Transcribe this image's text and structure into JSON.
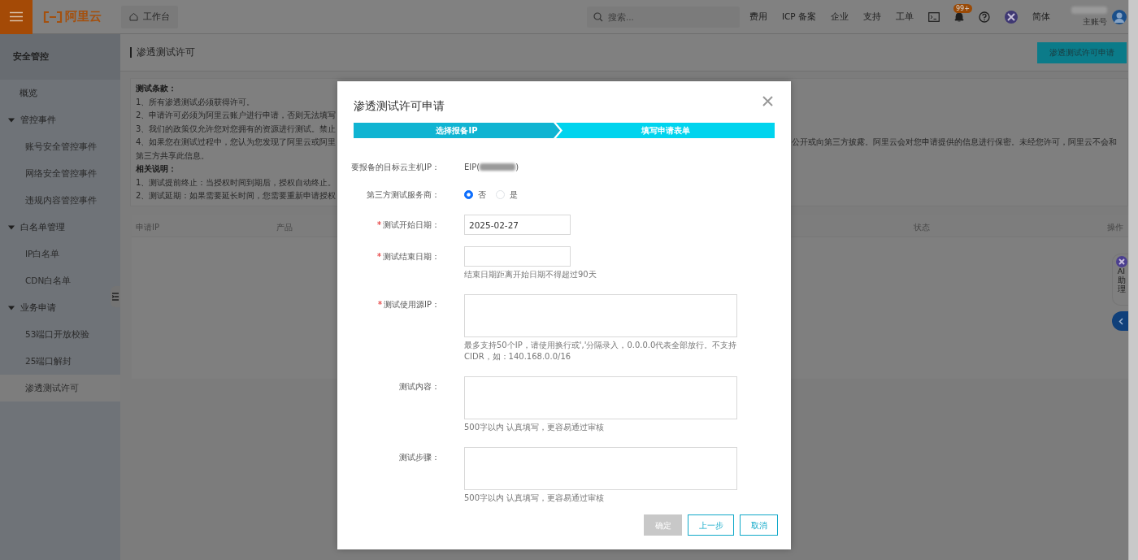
{
  "header": {
    "logo_text": "阿里云",
    "workbench": "工作台",
    "search": {
      "placeholder": "搜索..."
    },
    "links": [
      "费用",
      "ICP 备案",
      "企业",
      "支持",
      "工单"
    ],
    "notification_badge": "99+",
    "language": "简体",
    "account": {
      "name_redacted": true,
      "role": "主账号"
    }
  },
  "sidebar": {
    "title": "安全管控",
    "items": [
      {
        "label": "概览",
        "selected": false
      },
      {
        "label": "管控事件",
        "selected": false,
        "expanded": true,
        "children": [
          {
            "label": "账号安全管控事件",
            "selected": false
          },
          {
            "label": "网络安全管控事件",
            "selected": false
          },
          {
            "label": "违规内容管控事件",
            "selected": false
          }
        ]
      },
      {
        "label": "白名单管理",
        "selected": false,
        "expanded": true,
        "children": [
          {
            "label": "IP白名单",
            "selected": false
          },
          {
            "label": "CDN白名单",
            "selected": false
          }
        ]
      },
      {
        "label": "业务申请",
        "selected": false,
        "expanded": true,
        "children": [
          {
            "label": "53端口开放校验",
            "selected": false
          },
          {
            "label": "25端口解封",
            "selected": false
          },
          {
            "label": "渗透测试许可",
            "selected": true
          }
        ]
      }
    ]
  },
  "page": {
    "title": "渗透测试许可",
    "apply_button": "渗透测试许可申请",
    "notice": [
      {
        "kind": "heading",
        "text": "测试条款："
      },
      {
        "kind": "line",
        "text": "1、所有渗透测试必须获得许可。"
      },
      {
        "kind": "line",
        "text": "2、申请许可必须为阿里云账户进行申请，否则无法填写"
      },
      {
        "kind": "line",
        "text": "3、我们的政策仅允许您对您拥有的资源进行测试。禁止"
      },
      {
        "kind": "line",
        "text": "4、如果您在测试过程中，您认为您发现了阿里云或阿里",
        "text_right": "公开或向第三方披露。阿里云会对您申请提供的信息进行保密。未经您许可，阿里云不会和"
      },
      {
        "kind": "line",
        "text": "第三方共享此信息。"
      },
      {
        "kind": "heading",
        "text": "相关说明："
      },
      {
        "kind": "line",
        "text": "1、测试提前终止：当授权时间到期后，授权自动终止。"
      },
      {
        "kind": "line",
        "text": "2、测试延期：如果需要延长时间，您需要重新申请授权"
      }
    ],
    "table": {
      "columns": [
        "申请IP",
        "产品",
        "状态",
        "操作"
      ]
    }
  },
  "assistant": {
    "label_latin": "AI",
    "label_cjk": "助理"
  },
  "modal": {
    "title": "渗透测试许可申请",
    "steps": [
      {
        "label": "选择报备IP",
        "selected": false
      },
      {
        "label": "填写申请表单",
        "selected": true
      }
    ],
    "fields": [
      {
        "kind": "static",
        "label": "要报备的目标云主机IP：",
        "prefix": "EIP(",
        "suffix": ")",
        "redacted": true
      },
      {
        "kind": "radio",
        "label": "第三方测试服务商：",
        "options": [
          {
            "label": "否",
            "selected": true
          },
          {
            "label": "是",
            "selected": false
          }
        ]
      },
      {
        "kind": "input",
        "label": "测试开始日期：",
        "required": true,
        "value": "2025-02-27"
      },
      {
        "kind": "input",
        "label": "测试结束日期：",
        "required": true,
        "help": "结束日期距离开始日期不得超过90天"
      },
      {
        "kind": "textarea",
        "label": "测试使用源IP：",
        "required": true,
        "help": "最多支持50个IP，请使用换行或','分隔录入，0.0.0.0代表全部放行。不支持CIDR，如：140.168.0.0/16"
      },
      {
        "kind": "textarea",
        "label": "测试内容：",
        "required": false,
        "help": "500字以内 认真填写，更容易通过审核"
      },
      {
        "kind": "textarea",
        "label": "测试步骤：",
        "required": false,
        "help": "500字以内 认真填写，更容易通过审核"
      }
    ],
    "buttons": [
      {
        "label": "确定",
        "disabled": true
      },
      {
        "label": "上一步",
        "disabled": false
      },
      {
        "label": "取消",
        "disabled": false
      }
    ]
  }
}
